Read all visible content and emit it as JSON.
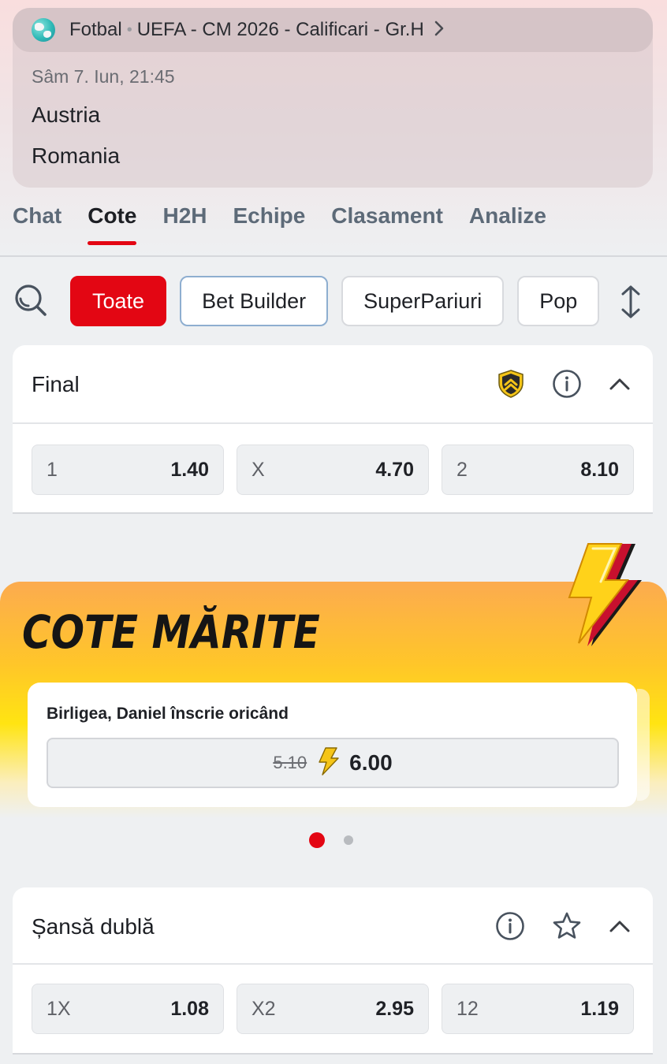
{
  "event": {
    "sport": "Fotbal",
    "competition": "UEFA - CM 2026 - Calificari - Gr.H",
    "datetime": "Sâm 7. Iun, 21:45",
    "home_team": "Austria",
    "away_team": "Romania"
  },
  "tabs": [
    {
      "label": "Chat",
      "active": false
    },
    {
      "label": "Cote",
      "active": true
    },
    {
      "label": "H2H",
      "active": false
    },
    {
      "label": "Echipe",
      "active": false
    },
    {
      "label": "Clasament",
      "active": false
    },
    {
      "label": "Analize",
      "active": false
    }
  ],
  "filters": [
    {
      "label": "Toate",
      "active": true
    },
    {
      "label": "Bet Builder",
      "active": false
    },
    {
      "label": "SuperPariuri",
      "active": false
    },
    {
      "label": "Pop",
      "active": false
    }
  ],
  "markets": [
    {
      "title": "Final",
      "icons": [
        "shield-boost-icon",
        "info-icon",
        "chevron-up-icon"
      ],
      "odds": [
        {
          "label": "1",
          "value": "1.40"
        },
        {
          "label": "X",
          "value": "4.70"
        },
        {
          "label": "2",
          "value": "8.10"
        }
      ]
    },
    {
      "title": "Șansă dublă",
      "icons": [
        "info-icon",
        "star-icon",
        "chevron-up-icon"
      ],
      "odds": [
        {
          "label": "1X",
          "value": "1.08"
        },
        {
          "label": "X2",
          "value": "2.95"
        },
        {
          "label": "12",
          "value": "1.19"
        }
      ]
    }
  ],
  "boost": {
    "title": "COTE MĂRITE",
    "selection": "Birligea, Daniel înscrie oricând",
    "old_odd": "5.10",
    "new_odd": "6.00",
    "pages": 2,
    "current_page": 1
  },
  "colors": {
    "accent": "#e30613",
    "boost_yellow": "#ffe412",
    "boost_orange": "#fcab4f"
  }
}
